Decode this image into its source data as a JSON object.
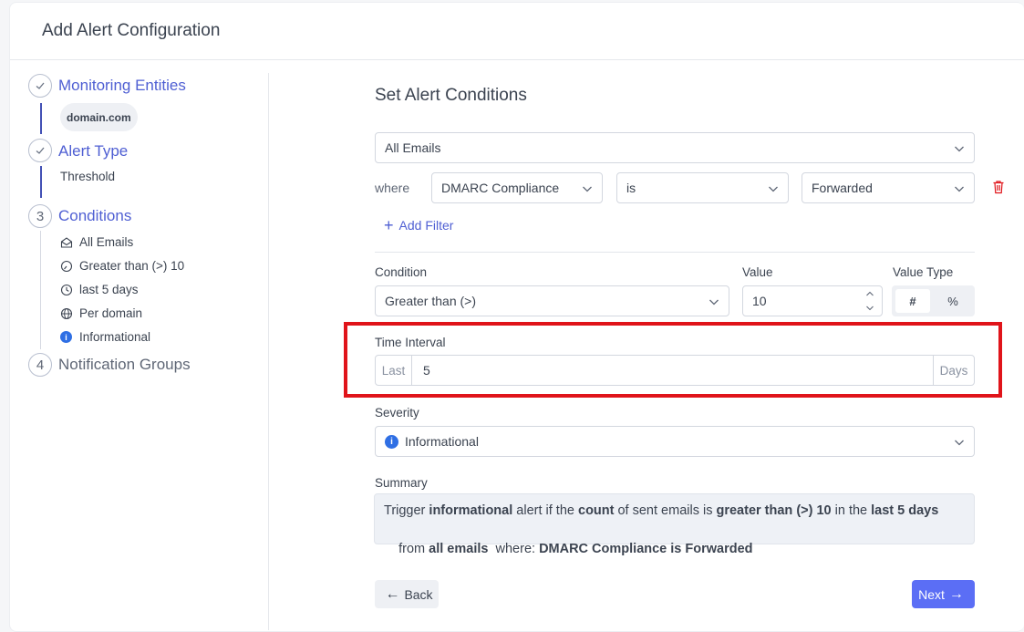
{
  "page": {
    "title": "Add Alert Configuration"
  },
  "stepper": {
    "steps": [
      {
        "label": "Monitoring Entities",
        "state": "done",
        "sub": "domain.com"
      },
      {
        "label": "Alert Type",
        "state": "done",
        "sub": "Threshold"
      },
      {
        "number": "3",
        "label": "Conditions",
        "state": "active",
        "items": [
          {
            "icon": "envelope-icon",
            "text": "All Emails"
          },
          {
            "icon": "gauge-icon",
            "text": "Greater than (>) 10"
          },
          {
            "icon": "clock-icon",
            "text": "last 5 days"
          },
          {
            "icon": "globe-icon",
            "text": "Per domain"
          },
          {
            "icon": "info-icon",
            "text": "Informational"
          }
        ]
      },
      {
        "number": "4",
        "label": "Notification Groups",
        "state": "pending"
      }
    ]
  },
  "conditions": {
    "title": "Set Alert Conditions",
    "scope_select": "All Emails",
    "filter": {
      "where_label": "where",
      "field": "DMARC Compliance",
      "operator": "is",
      "value": "Forwarded"
    },
    "add_filter_label": "Add Filter",
    "condition_label": "Condition",
    "condition_value": "Greater than (>)",
    "value_label": "Value",
    "value": "10",
    "value_type_label": "Value Type",
    "value_type_options": [
      "#",
      "%"
    ],
    "value_type_selected": "#",
    "time_interval_label": "Time Interval",
    "time_prefix": "Last",
    "time_value": "5",
    "time_suffix": "Days",
    "severity_label": "Severity",
    "severity_value": "Informational",
    "summary_label": "Summary"
  },
  "summary": {
    "t1": "Trigger ",
    "b1": "informational",
    "t2": " alert if the ",
    "b2": "count",
    "t3": " of sent emails is ",
    "b3": "greater than (>) 10",
    "t4": " in the ",
    "b4": "last 5 days",
    "t5": "from ",
    "b5": "all emails",
    "t6": "  where: ",
    "b6": "DMARC Compliance is Forwarded"
  },
  "buttons": {
    "back": "Back",
    "next": "Next"
  },
  "colors": {
    "accent": "#5b6ef5",
    "highlight": "#e0141a",
    "info": "#2f6fe4"
  }
}
